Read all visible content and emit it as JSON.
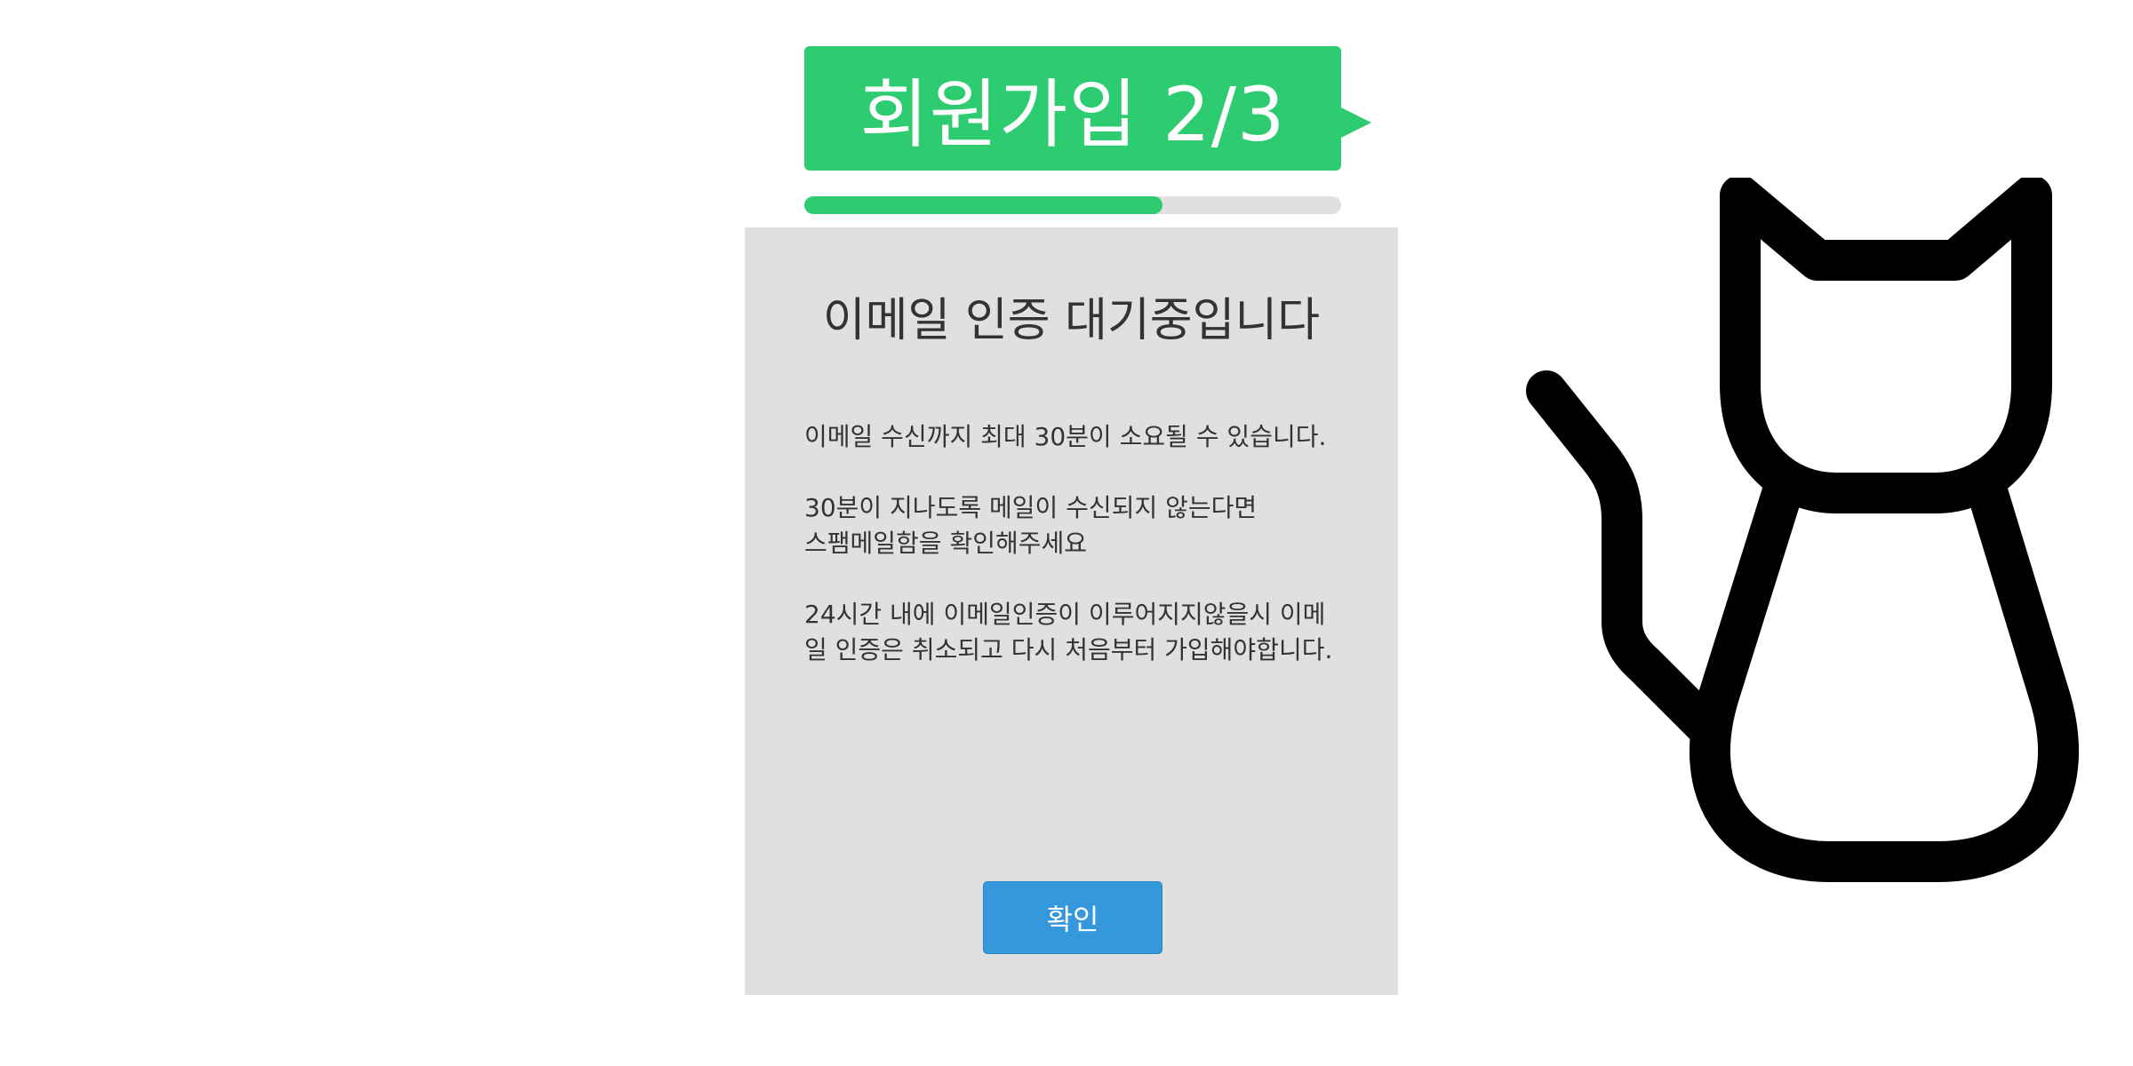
{
  "header": {
    "title": "회원가입 2/3",
    "progress": {
      "current_step": 2,
      "total_steps": 3,
      "fraction": 0.667
    },
    "accent_color": "#2ecc71"
  },
  "panel": {
    "title": "이메일 인증 대기중입니다",
    "paragraphs": [
      "이메일 수신까지 최대 30분이 소요될 수 있습니다.",
      "30분이 지나도록 메일이 수신되지 않는다면\n스팸메일함을 확인해주세요",
      "24시간 내에 이메일인증이 이루어지지않을시 이메\n일 인증은 취소되고 다시 처음부터 가입해야합니다."
    ],
    "confirm_label": "확인",
    "button_color": "#3498db"
  },
  "illustration": {
    "icon": "cat-icon"
  }
}
